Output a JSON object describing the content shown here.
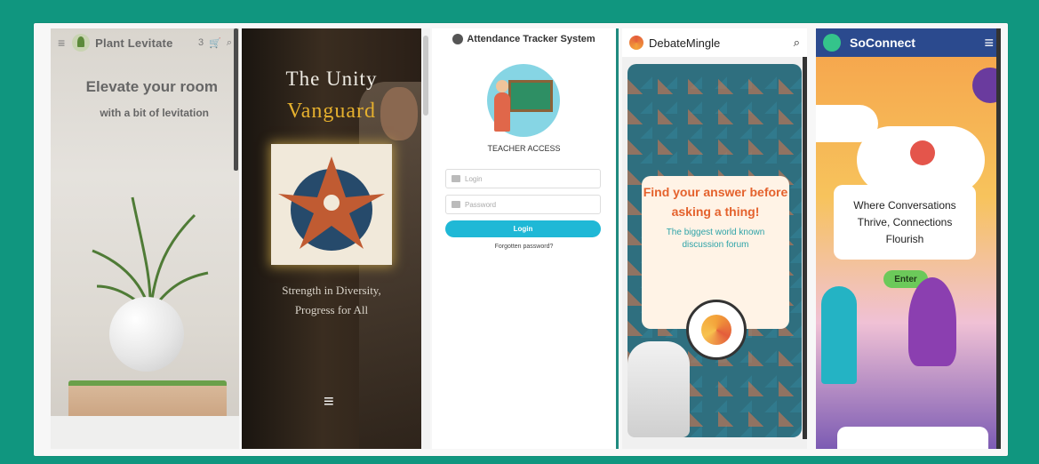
{
  "panels": {
    "plant_levitate": {
      "brand": "Plant Levitate",
      "cart_count": "3",
      "headline": "Elevate your room",
      "subheadline": "with a bit of levitation",
      "menu_icon": "menu-icon",
      "cart_icon": "cart-icon",
      "search_icon": "search-icon"
    },
    "unity_vanguard": {
      "title_line1": "The Unity",
      "title_line2": "Vanguard",
      "tagline_line1": "Strength in Diversity,",
      "tagline_line2": "Progress for All",
      "menu_icon": "menu-icon"
    },
    "attendance": {
      "title": "Attendance Tracker System",
      "access_label": "TEACHER ACCESS",
      "login_placeholder": "Login",
      "password_placeholder": "Password",
      "login_button": "Login",
      "forgot_link": "Forgotten password?"
    },
    "debatemingle": {
      "brand": "DebateMingle",
      "headline_line1": "Find your answer before",
      "headline_line2": "asking a thing!",
      "sub_line1": "The biggest world known",
      "sub_line2": "discussion forum",
      "search_icon": "search-icon"
    },
    "soconnect": {
      "brand": "SoConnect",
      "tag_line1": "Where Conversations",
      "tag_line2": "Thrive, Connections",
      "tag_line3": "Flourish",
      "enter_button": "Enter",
      "menu_icon": "menu-icon"
    }
  },
  "colors": {
    "background": "#10967f",
    "gold": "#e5b02e",
    "cyan_button": "#1fb8d6",
    "orange_text": "#e4622d",
    "teal_text": "#2ea3a8",
    "soconnect_header": "#2b4a8e",
    "enter_green": "#6cc95a"
  }
}
